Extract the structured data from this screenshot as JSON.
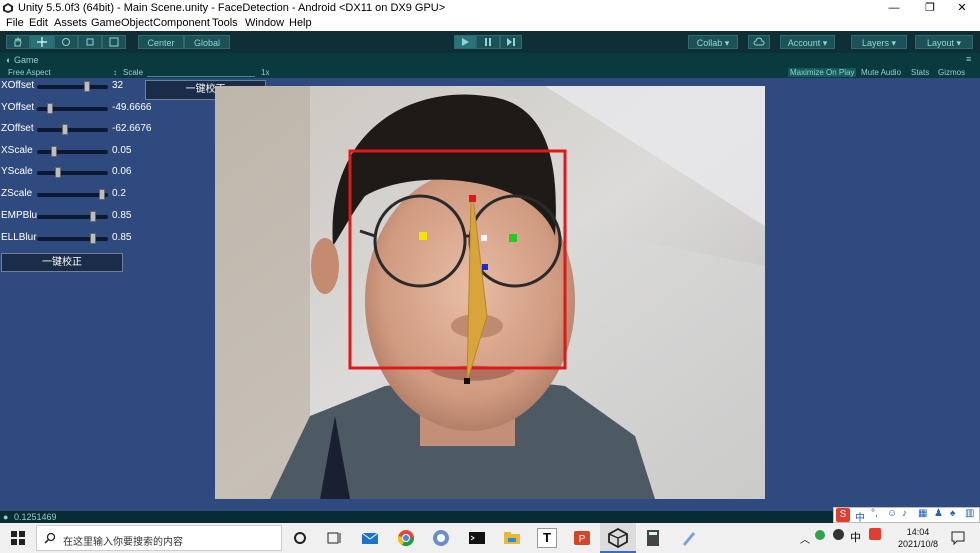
{
  "window": {
    "title": "Unity 5.5.0f3 (64bit) - Main Scene.unity - FaceDetection - Android <DX11 on DX9 GPU>",
    "minimize": "—",
    "maximize": "❐",
    "close": "✕"
  },
  "menu": [
    "File",
    "Edit",
    "Assets",
    "GameObject",
    "Component",
    "Tools",
    "Window",
    "Help"
  ],
  "toolbar": {
    "center_label": "Center",
    "global_label": "Global",
    "collab_label": "Collab",
    "account_label": "Account",
    "layers_label": "Layers",
    "layout_label": "Layout"
  },
  "game": {
    "tab_label": "Game",
    "aspect_label": "Free Aspect",
    "scale_label": "Scale",
    "scale_value": "1x",
    "options": [
      "Maximize On Play",
      "Mute Audio",
      "Stats",
      "Gizmos"
    ]
  },
  "panel": {
    "top_button": "一键校正",
    "bottom_button": "一键校正",
    "sliders": [
      {
        "label": "XOffset",
        "value": "32",
        "level": 0.72
      },
      {
        "label": "YOffset",
        "value": "-49.6666",
        "level": 0.15
      },
      {
        "label": "ZOffset",
        "value": "-62.6676",
        "level": 0.38
      },
      {
        "label": "XScale",
        "value": "0.05",
        "level": 0.22
      },
      {
        "label": "YScale",
        "value": "0.06",
        "level": 0.27
      },
      {
        "label": "ZScale",
        "value": "0.2",
        "level": 0.95
      },
      {
        "label": "EMPBlu",
        "value": "0.85",
        "level": 0.82
      },
      {
        "label": "ELLBlur",
        "value": "0.85",
        "level": 0.82
      }
    ]
  },
  "status": {
    "message": "0.1251469"
  },
  "taskbar": {
    "search_placeholder": "在这里输入你要搜索的内容",
    "time": "14:04",
    "date": "2021/10/8",
    "ime_label": "中",
    "tray_ime": "中"
  },
  "colors": {
    "detect_box": "#e01818",
    "nose_line": "#d9a53a",
    "marker_red": "#e01818",
    "marker_yellow": "#f2e600",
    "marker_green": "#22cc22",
    "marker_blue": "#1a2ad6",
    "marker_black": "#111111"
  }
}
